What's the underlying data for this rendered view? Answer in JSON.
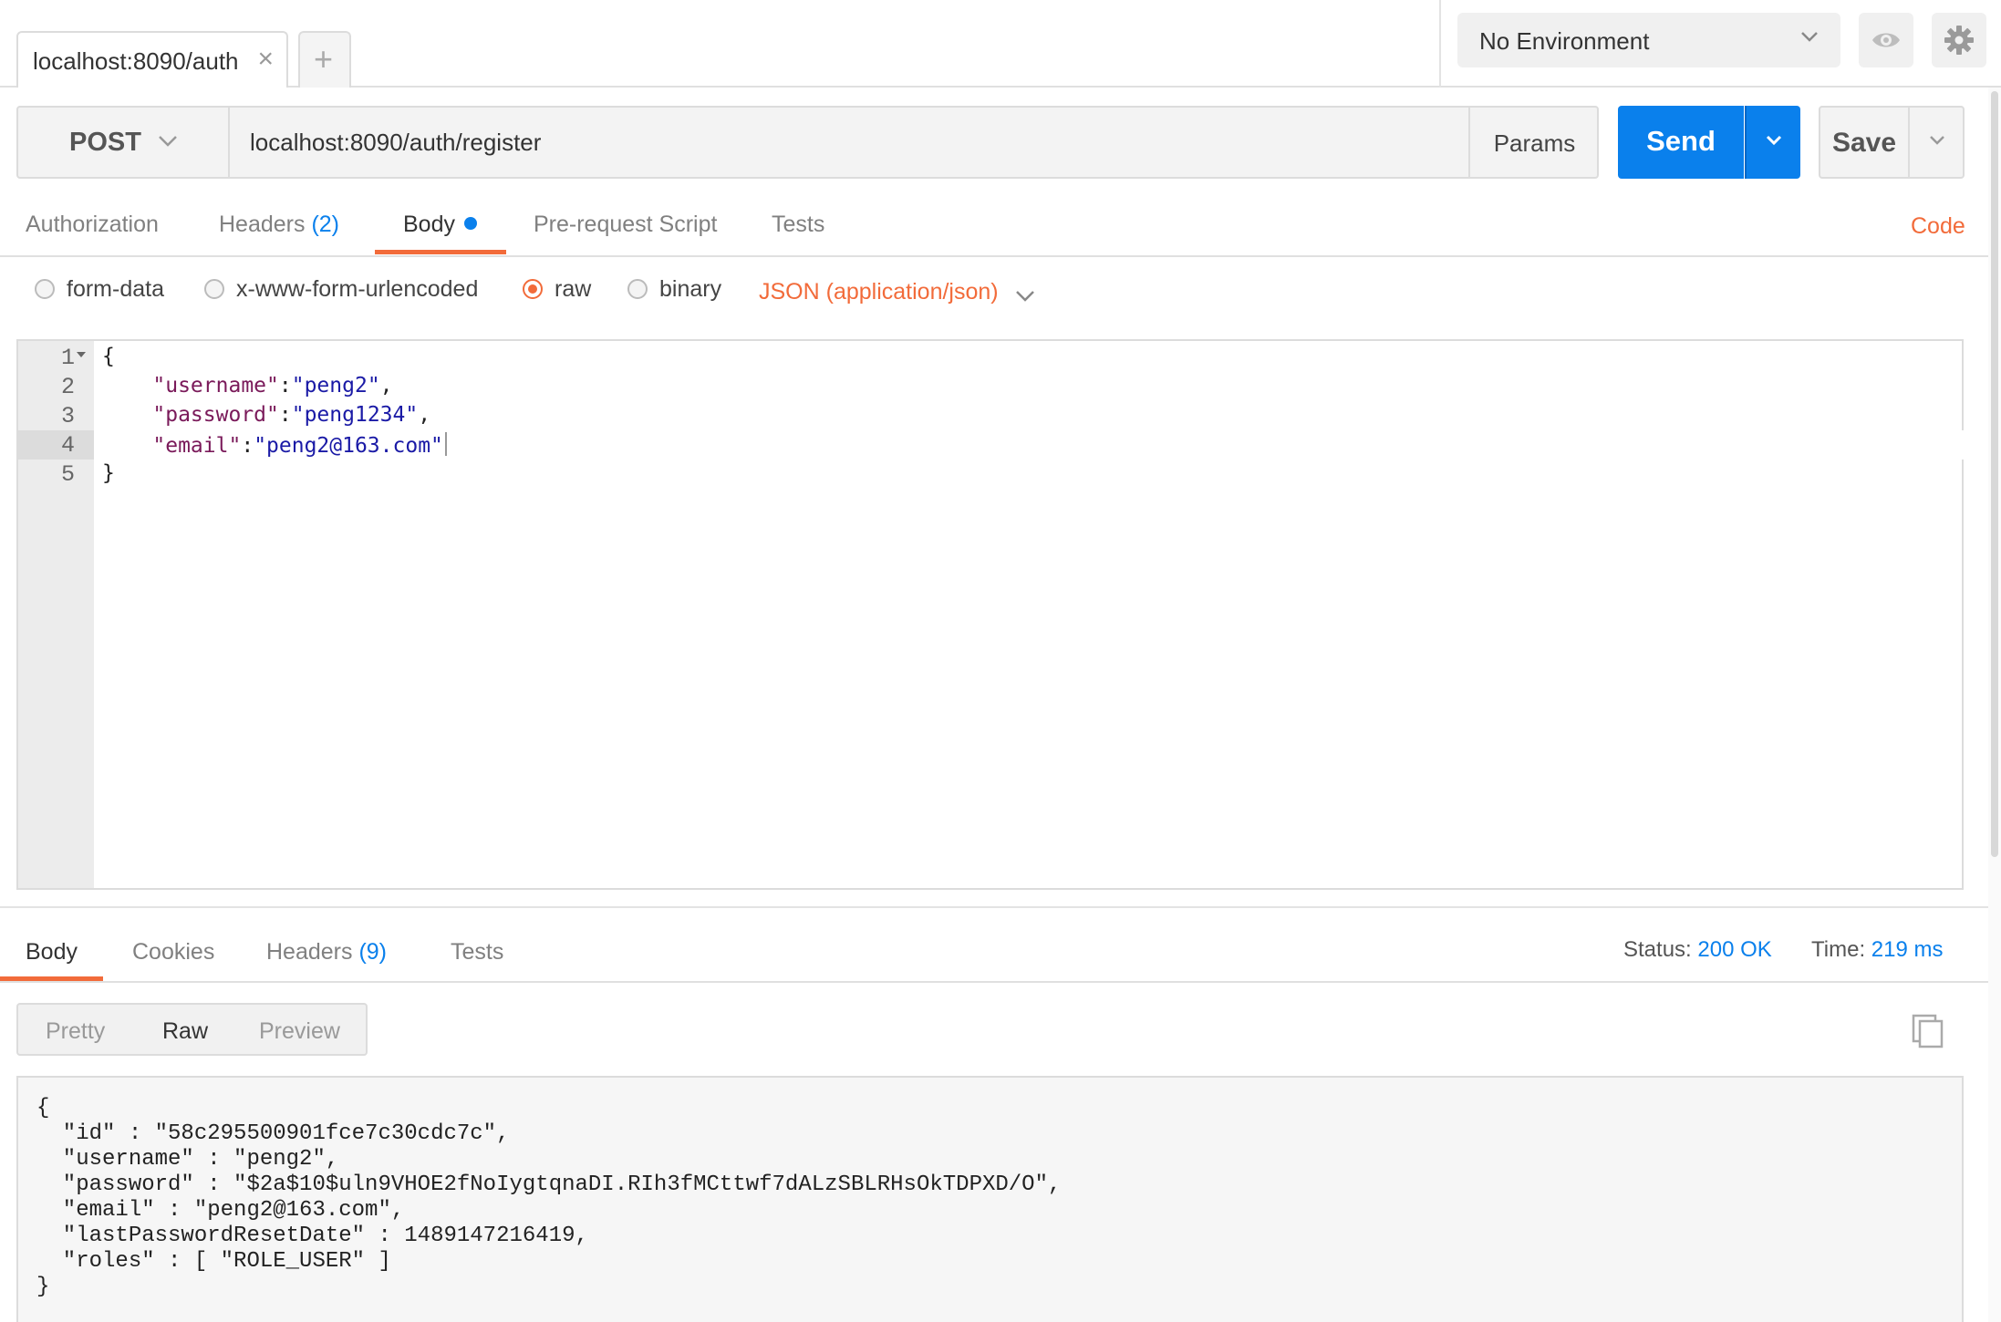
{
  "tabs": {
    "active_tab_label": "localhost:8090/auth",
    "close_glyph": "×",
    "new_tab_glyph": "+"
  },
  "environment": {
    "selected": "No Environment"
  },
  "request": {
    "method": "POST",
    "url": "localhost:8090/auth/register",
    "params_label": "Params",
    "send_label": "Send",
    "save_label": "Save"
  },
  "request_tabs": {
    "authorization": "Authorization",
    "headers": "Headers",
    "headers_count": "(2)",
    "body": "Body",
    "pre_request": "Pre-request Script",
    "tests": "Tests",
    "code_link": "Code"
  },
  "body_types": {
    "form_data": "form-data",
    "urlencoded": "x-www-form-urlencoded",
    "raw": "raw",
    "binary": "binary",
    "selected": "raw",
    "content_type": "JSON (application/json)"
  },
  "editor": {
    "line_numbers": [
      "1",
      "2",
      "3",
      "4",
      "5"
    ],
    "active_line": "4",
    "lines": {
      "open": "{",
      "username_key": "\"username\"",
      "username_val": "\"peng2\"",
      "password_key": "\"password\"",
      "password_val": "\"peng1234\"",
      "email_key": "\"email\"",
      "email_val": "\"peng2@163.com\"",
      "close": "}"
    }
  },
  "response": {
    "tabs": {
      "body": "Body",
      "cookies": "Cookies",
      "headers": "Headers",
      "headers_count": "(9)",
      "tests": "Tests"
    },
    "status_label": "Status:",
    "status_value": "200 OK",
    "time_label": "Time:",
    "time_value": "219 ms",
    "view_modes": [
      "Pretty",
      "Raw",
      "Preview"
    ],
    "selected_view": "Raw",
    "body_text": "{\n  \"id\" : \"58c295500901fce7c30cdc7c\",\n  \"username\" : \"peng2\",\n  \"password\" : \"$2a$10$uln9VHOE2fNoIygtqnaDI.RIh3fMCttwf7dALzSBLRHsOkTDPXD/O\",\n  \"email\" : \"peng2@163.com\",\n  \"lastPasswordResetDate\" : 1489147216419,\n  \"roles\" : [ \"ROLE_USER\" ]\n}"
  },
  "colors": {
    "accent_orange": "#f26b3a",
    "send_blue": "#0a80ec",
    "json_key": "#7a1a5a",
    "json_string": "#1a1aa6"
  },
  "icons": [
    "close-icon",
    "plus-icon",
    "chevron-down-icon",
    "eye-icon",
    "gear-icon",
    "copy-icon"
  ]
}
